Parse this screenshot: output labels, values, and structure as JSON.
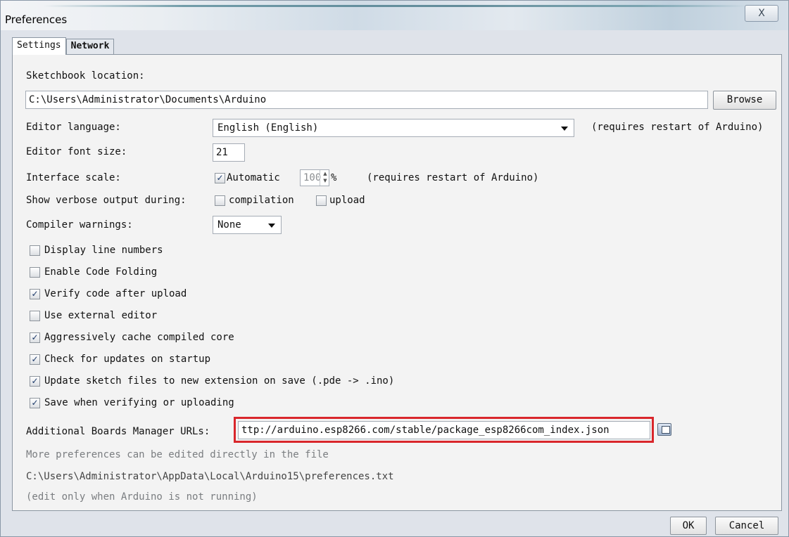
{
  "window": {
    "title": "Preferences",
    "close_glyph": "X",
    "close_icon": "close-icon"
  },
  "tabs": [
    {
      "label": "Settings",
      "active": true
    },
    {
      "label": "Network",
      "active": false
    }
  ],
  "settings": {
    "sketchbook_label": "Sketchbook location:",
    "sketchbook_value": "C:\\Users\\Administrator\\Documents\\Arduino",
    "browse_label": "Browse",
    "editor_language_label": "Editor language:",
    "editor_language_value": "English (English)",
    "editor_language_note": "(requires restart of Arduino)",
    "font_size_label": "Editor font size:",
    "font_size_value": "21",
    "interface_scale_label": "Interface scale:",
    "automatic_label": "Automatic",
    "automatic_checked": true,
    "scale_value": "100",
    "scale_unit": "%",
    "scale_note": "(requires restart of Arduino)",
    "verbose_label": "Show verbose output during:",
    "compilation_label": "compilation",
    "compilation_checked": false,
    "upload_label": "upload",
    "upload_checked": false,
    "compiler_warnings_label": "Compiler warnings:",
    "compiler_warnings_value": "None",
    "options": [
      {
        "label": "Display line numbers",
        "checked": false
      },
      {
        "label": "Enable Code Folding",
        "checked": false
      },
      {
        "label": "Verify code after upload",
        "checked": true
      },
      {
        "label": "Use external editor",
        "checked": false
      },
      {
        "label": "Aggressively cache compiled core",
        "checked": true
      },
      {
        "label": "Check for updates on startup",
        "checked": true
      },
      {
        "label": "Update sketch files to new extension on save (.pde -> .ino)",
        "checked": true
      },
      {
        "label": "Save when verifying or uploading",
        "checked": true
      }
    ],
    "boards_url_label": "Additional Boards Manager URLs:",
    "boards_url_value": "ttp://arduino.esp8266.com/stable/package_esp8266com_index.json",
    "more_prefs_line1": "More preferences can be edited directly in the file",
    "more_prefs_path": "C:\\Users\\Administrator\\AppData\\Local\\Arduino15\\preferences.txt",
    "more_prefs_note": "(edit only when Arduino is not running)"
  },
  "footer": {
    "ok_label": "OK",
    "cancel_label": "Cancel"
  },
  "colors": {
    "highlight_border": "#d9262b",
    "check_mark": "#1d3a6a"
  }
}
